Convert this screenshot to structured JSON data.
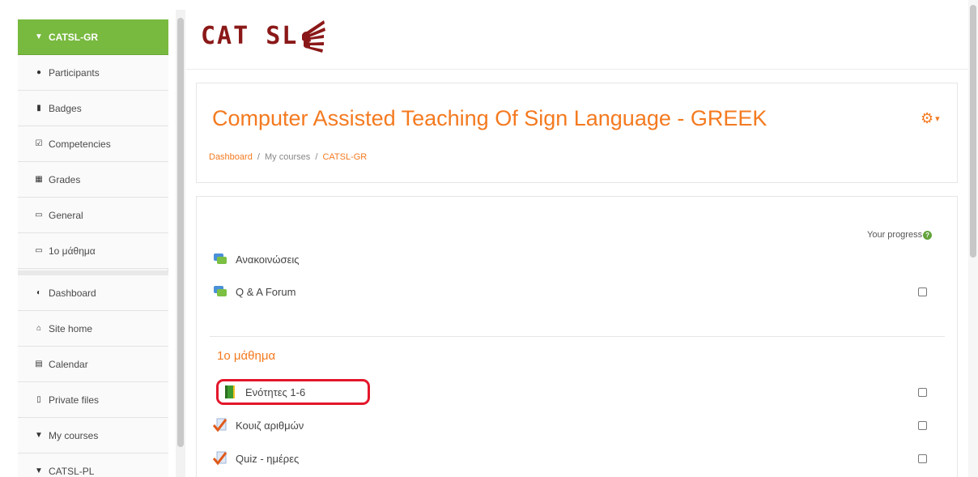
{
  "sidebar": {
    "items": [
      {
        "label": "CATSL-GR",
        "icon": "graduation-cap-icon",
        "active": true
      },
      {
        "label": "Participants",
        "icon": "users-icon"
      },
      {
        "label": "Badges",
        "icon": "shield-icon"
      },
      {
        "label": "Competencies",
        "icon": "checkbox-icon"
      },
      {
        "label": "Grades",
        "icon": "table-icon"
      },
      {
        "label": "General",
        "icon": "folder-icon"
      },
      {
        "label": "1ο μάθημα",
        "icon": "folder-icon"
      },
      {
        "label": "Dashboard",
        "icon": "dashboard-icon"
      },
      {
        "label": "Site home",
        "icon": "home-icon"
      },
      {
        "label": "Calendar",
        "icon": "calendar-icon"
      },
      {
        "label": "Private files",
        "icon": "file-icon"
      },
      {
        "label": "My courses",
        "icon": "graduation-cap-icon"
      },
      {
        "label": "CATSL-PL",
        "icon": "graduation-cap-icon"
      }
    ]
  },
  "header": {
    "logo_text": "CAT SL"
  },
  "course": {
    "title": "Computer Assisted Teaching Of Sign Language - GREEK",
    "breadcrumb": {
      "dashboard": "Dashboard",
      "my_courses": "My courses",
      "course": "CATSL-GR",
      "separator": "/"
    },
    "gear_icon": "gear-icon",
    "gear_caret": "▾"
  },
  "content": {
    "progress_label": "Your progress",
    "help_glyph": "?",
    "top_activities": [
      {
        "label": "Ανακοινώσεις",
        "icon": "forum-icon",
        "has_checkbox": false
      },
      {
        "label": "Q & A Forum",
        "icon": "forum-icon",
        "has_checkbox": true
      }
    ],
    "section": {
      "title": "1ο μάθημα",
      "activities": [
        {
          "label": "Ενότητες 1-6",
          "icon": "book-icon",
          "has_checkbox": true,
          "highlighted": true
        },
        {
          "label": "Κουιζ αριθμών",
          "icon": "quiz-icon",
          "has_checkbox": true
        },
        {
          "label": "Quiz - ημέρες",
          "icon": "quiz-icon",
          "has_checkbox": true
        }
      ]
    }
  },
  "colors": {
    "accent": "#f47a20",
    "active_nav": "#78b93f",
    "logo": "#8b1818",
    "highlight": "#e3172b"
  }
}
